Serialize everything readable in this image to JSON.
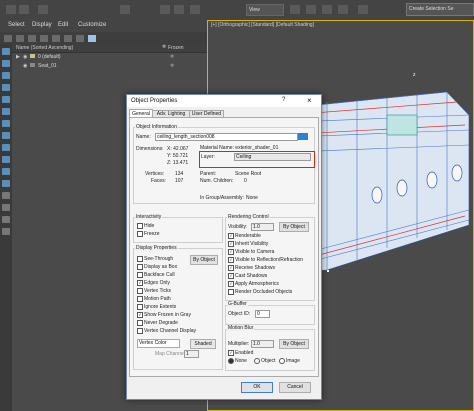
{
  "menu": {
    "select": "Select",
    "display": "Display",
    "edit": "Edit",
    "customize": "Customize"
  },
  "top": {
    "view_dropdown": "View",
    "selection_set": "Create Selection Se"
  },
  "scene_explorer": {
    "col_name": "Name (Sorted Ascending)",
    "col_frozen": "Frozen",
    "rows": [
      {
        "label": "0 (default)"
      },
      {
        "label": "Seat_01"
      }
    ]
  },
  "viewport": {
    "label": "[+] [Orthographic] [Standard] [Default Shading]",
    "marker": "z"
  },
  "dialog": {
    "title": "Object Properties",
    "help": "?",
    "close": "×",
    "tabs": [
      "General",
      "Adv. Lighting",
      "User Defined"
    ],
    "object_info": {
      "group": "Object Information",
      "name_label": "Name:",
      "name_value": "ceiling_length_section008",
      "dimensions_label": "Dimensions:",
      "x": "X: 42.067",
      "y": "Y: 50.721",
      "z": "Z: 13.471",
      "material_name": "Material Name: exterior_shader_01",
      "layer_label": "Layer:",
      "layer_value": "Ceiling",
      "vertices_label": "Vertices:",
      "vertices_value": "134",
      "faces_label": "Faces:",
      "faces_value": "107",
      "parent_label": "Parent:",
      "parent_value": "Scene Root",
      "numchildren_label": "Num. Children:",
      "numchildren_value": "0",
      "ingroup_label": "In Group/Assembly:",
      "ingroup_value": "None"
    },
    "interactivity": {
      "group": "Interactivity",
      "hide": "Hide",
      "freeze": "Freeze"
    },
    "display_properties": {
      "group": "Display Properties",
      "by_object": "By Object",
      "items": [
        "See-Through",
        "Display as Box",
        "Backface Cull",
        "Edges Only",
        "Vertex Ticks",
        "Motion Path",
        "Ignore Extents",
        "Show Frozen in Gray",
        "Never Degrade",
        "Vertex Channel Display"
      ],
      "checked": [
        false,
        false,
        false,
        true,
        false,
        false,
        false,
        true,
        false,
        false
      ],
      "vertex_color": "Vertex Color",
      "shaded": "Shaded",
      "map_channel_label": "Map Channel:",
      "map_channel_value": "1"
    },
    "rendering_control": {
      "group": "Rendering Control",
      "visibility_label": "Visibility:",
      "visibility_value": "1.0",
      "by_object": "By Object",
      "items": [
        "Renderable",
        "Inherit Visibility",
        "Visible to Camera",
        "Visible to Reflection/Refraction",
        "Receive Shadows",
        "Cast Shadows",
        "Apply Atmospherics",
        "Render Occluded Objects"
      ],
      "checked": [
        true,
        true,
        true,
        true,
        true,
        true,
        true,
        false
      ]
    },
    "gbuffer": {
      "group": "G-Buffer",
      "object_id_label": "Object ID:",
      "object_id_value": "0"
    },
    "motion_blur": {
      "group": "Motion Blur",
      "multiplier_label": "Multiplier:",
      "multiplier_value": "1.0",
      "by_object": "By Object",
      "enabled": "Enabled",
      "none": "None",
      "object": "Object",
      "image": "Image"
    },
    "ok": "OK",
    "cancel": "Cancel"
  },
  "colors": {
    "highlight_box": "#d9202a",
    "dialog_border": "#6b8bb0",
    "wire": "#4a78c8"
  }
}
